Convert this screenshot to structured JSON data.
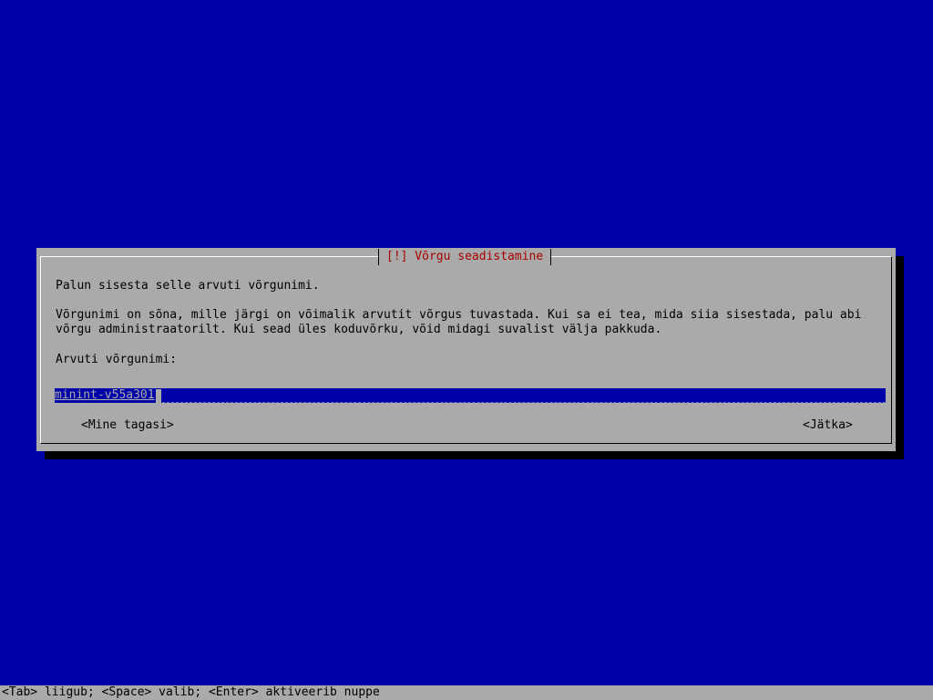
{
  "dialog": {
    "title": "[!] Võrgu seadistamine",
    "prompt": "Palun sisesta selle arvuti võrgunimi.",
    "description_line1": "Võrgunimi on sõna, mille järgi on võimalik arvutit võrgus tuvastada. Kui sa ei tea, mida siia sisestada, palu abi",
    "description_line2": "võrgu administraatorilt. Kui sead üles koduvõrku, võid midagi suvalist välja pakkuda.",
    "field_label": "Arvuti võrgunimi:",
    "field_value": "minint-v55a301",
    "back_button": "<Mine tagasi>",
    "continue_button": "<Jätka>"
  },
  "status_bar": {
    "text": "<Tab> liigub; <Space> valib; <Enter> aktiveerib nuppe"
  },
  "colors": {
    "background": "#0000a8",
    "dialog": "#aaaaaa",
    "title": "#a80000",
    "field_bg": "#0000a8"
  }
}
